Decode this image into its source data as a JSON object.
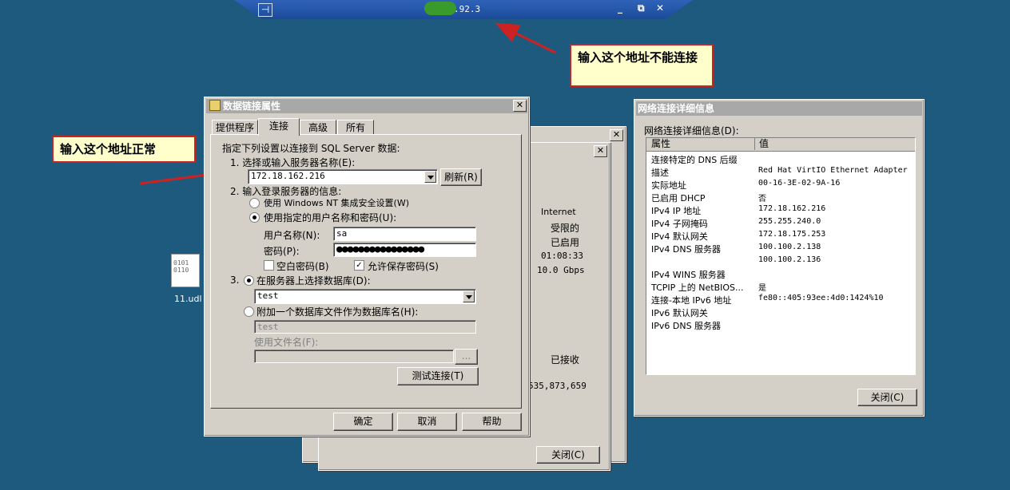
{
  "remote_bar": {
    "address": "   .92.3"
  },
  "annotations": {
    "bad": "输入这个地址不能连接",
    "good": "输入这个地址正常"
  },
  "back_windows": {
    "internet": "Internet",
    "limited": "受限的",
    "enabled": "已启用",
    "duration": "01:08:33",
    "speed": "10.0 Gbps",
    "received_label": "已接收",
    "received_value": "535,873,659",
    "close": "关闭(C)"
  },
  "desktop_icon": {
    "label": "11.udl",
    "glyph": "0101\n0110"
  },
  "dialog": {
    "title": "数据链接属性",
    "tabs": [
      "提供程序",
      "连接",
      "高级",
      "所有"
    ],
    "intro": "指定下列设置以连接到 SQL Server 数据:",
    "step1": "1. 选择或输入服务器名称(E):",
    "server": "172.18.162.216",
    "refresh": "刷新(R)",
    "step2": "2. 输入登录服务器的信息:",
    "opt_nt": "使用 Windows NT 集成安全设置(W)",
    "opt_user": "使用指定的用户名称和密码(U):",
    "user_label": "用户名称(N):",
    "user_value": "sa",
    "pwd_label": "密码(P):",
    "pwd_value": "●●●●●●●●●●●●●●●●",
    "blank_pwd": "空白密码(B)",
    "save_pwd": "允许保存密码(S)",
    "step3": "3.",
    "select_db": "在服务器上选择数据库(D):",
    "db_value": "test",
    "attach_db": "附加一个数据库文件作为数据库名(H):",
    "attach_value": "test",
    "file_label": "使用文件名(F):",
    "browse": "...",
    "test_btn": "测试连接(T)",
    "ok": "确定",
    "cancel": "取消",
    "help": "帮助"
  },
  "netinfo": {
    "title": "网络连接详细信息",
    "caption": "网络连接详细信息(D):",
    "col_prop": "属性",
    "col_val": "值",
    "rows": [
      [
        "连接特定的 DNS 后缀",
        ""
      ],
      [
        "描述",
        "Red Hat VirtIO Ethernet Adapter"
      ],
      [
        "实际地址",
        "00-16-3E-02-9A-16"
      ],
      [
        "已启用 DHCP",
        "否"
      ],
      [
        "IPv4 IP 地址",
        "172.18.162.216"
      ],
      [
        "IPv4 子网掩码",
        "255.255.240.0"
      ],
      [
        "IPv4 默认网关",
        "172.18.175.253"
      ],
      [
        "IPv4 DNS 服务器",
        "100.100.2.138"
      ],
      [
        "",
        "100.100.2.136"
      ],
      [
        "IPv4 WINS 服务器",
        ""
      ],
      [
        "TCPIP 上的 NetBIOS...",
        "是"
      ],
      [
        "连接-本地 IPv6 地址",
        "fe80::405:93ee:4d0:1424%10"
      ],
      [
        "IPv6 默认网关",
        ""
      ],
      [
        "IPv6 DNS 服务器",
        ""
      ]
    ],
    "close": "关闭(C)"
  },
  "colors": {
    "desktop": "#1d5a7e",
    "arrow": "#cc2222",
    "note_bg": "#ffffcc"
  }
}
